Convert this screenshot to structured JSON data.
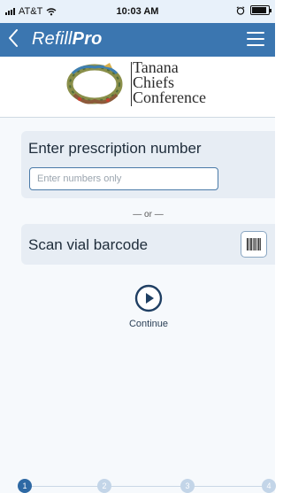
{
  "status_bar": {
    "carrier": "AT&T",
    "time": "10:03 AM"
  },
  "nav": {
    "title_light": "Refill",
    "title_bold": "Pro"
  },
  "logo": {
    "line1": "Tanana",
    "line2": "Chiefs",
    "line3": "Conference"
  },
  "rx_card": {
    "heading": "Enter prescription number",
    "placeholder": "Enter numbers only",
    "value": ""
  },
  "divider_text": "— or —",
  "scan_card": {
    "heading": "Scan vial barcode"
  },
  "continue_label": "Continue",
  "steps": [
    "1",
    "2",
    "3",
    "4"
  ],
  "active_step": 1,
  "colors": {
    "nav_bg": "#3b76b0",
    "active_step": "#2e69a4",
    "inactive_step": "#c3d5e8",
    "card_bg": "#e7edf4"
  },
  "icons": {
    "back": "chevron-left-icon",
    "menu": "hamburger-menu-icon",
    "barcode": "barcode-icon",
    "continue": "play-circle-icon"
  }
}
